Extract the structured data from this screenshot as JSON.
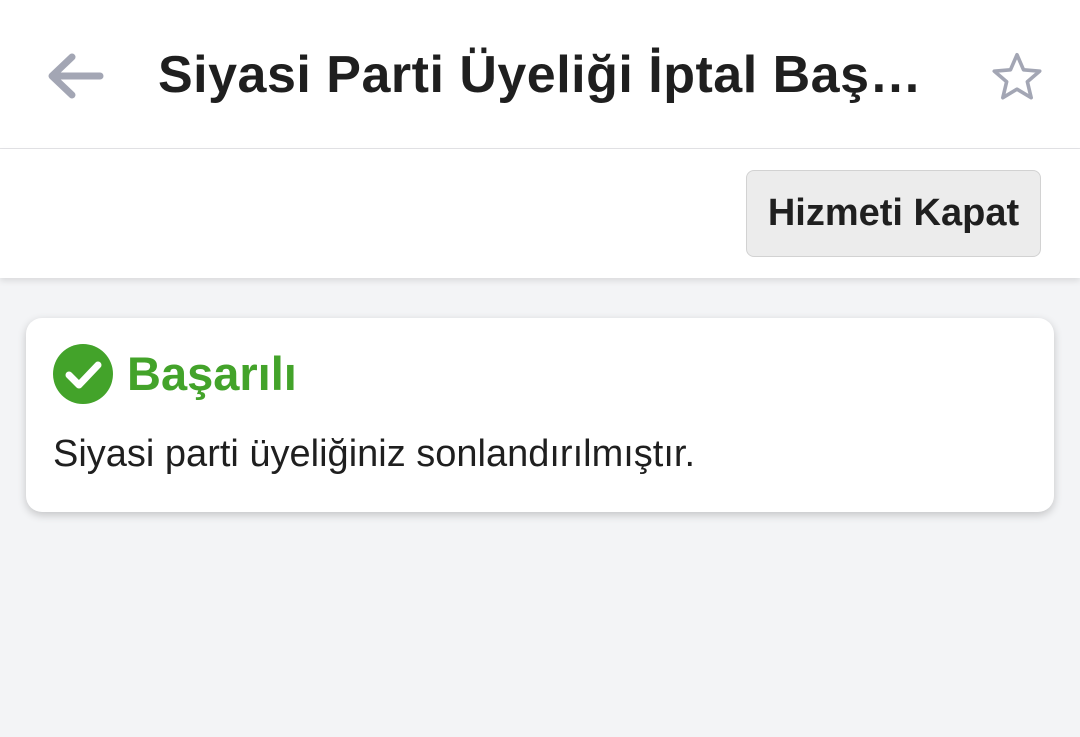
{
  "header": {
    "title": "Siyasi Parti Üyeliği İptal Başvurusu",
    "back_icon": "arrow-left-icon",
    "favorite_icon": "star-outline-icon"
  },
  "toolbar": {
    "close_service_label": "Hizmeti Kapat"
  },
  "result": {
    "status_icon": "check-circle-icon",
    "status_label": "Başarılı",
    "message": "Siyasi parti üyeliğiniz sonlandırılmıştır."
  },
  "colors": {
    "success": "#43a32a",
    "icon_gray": "#a3a6b4",
    "background": "#f3f4f6"
  }
}
